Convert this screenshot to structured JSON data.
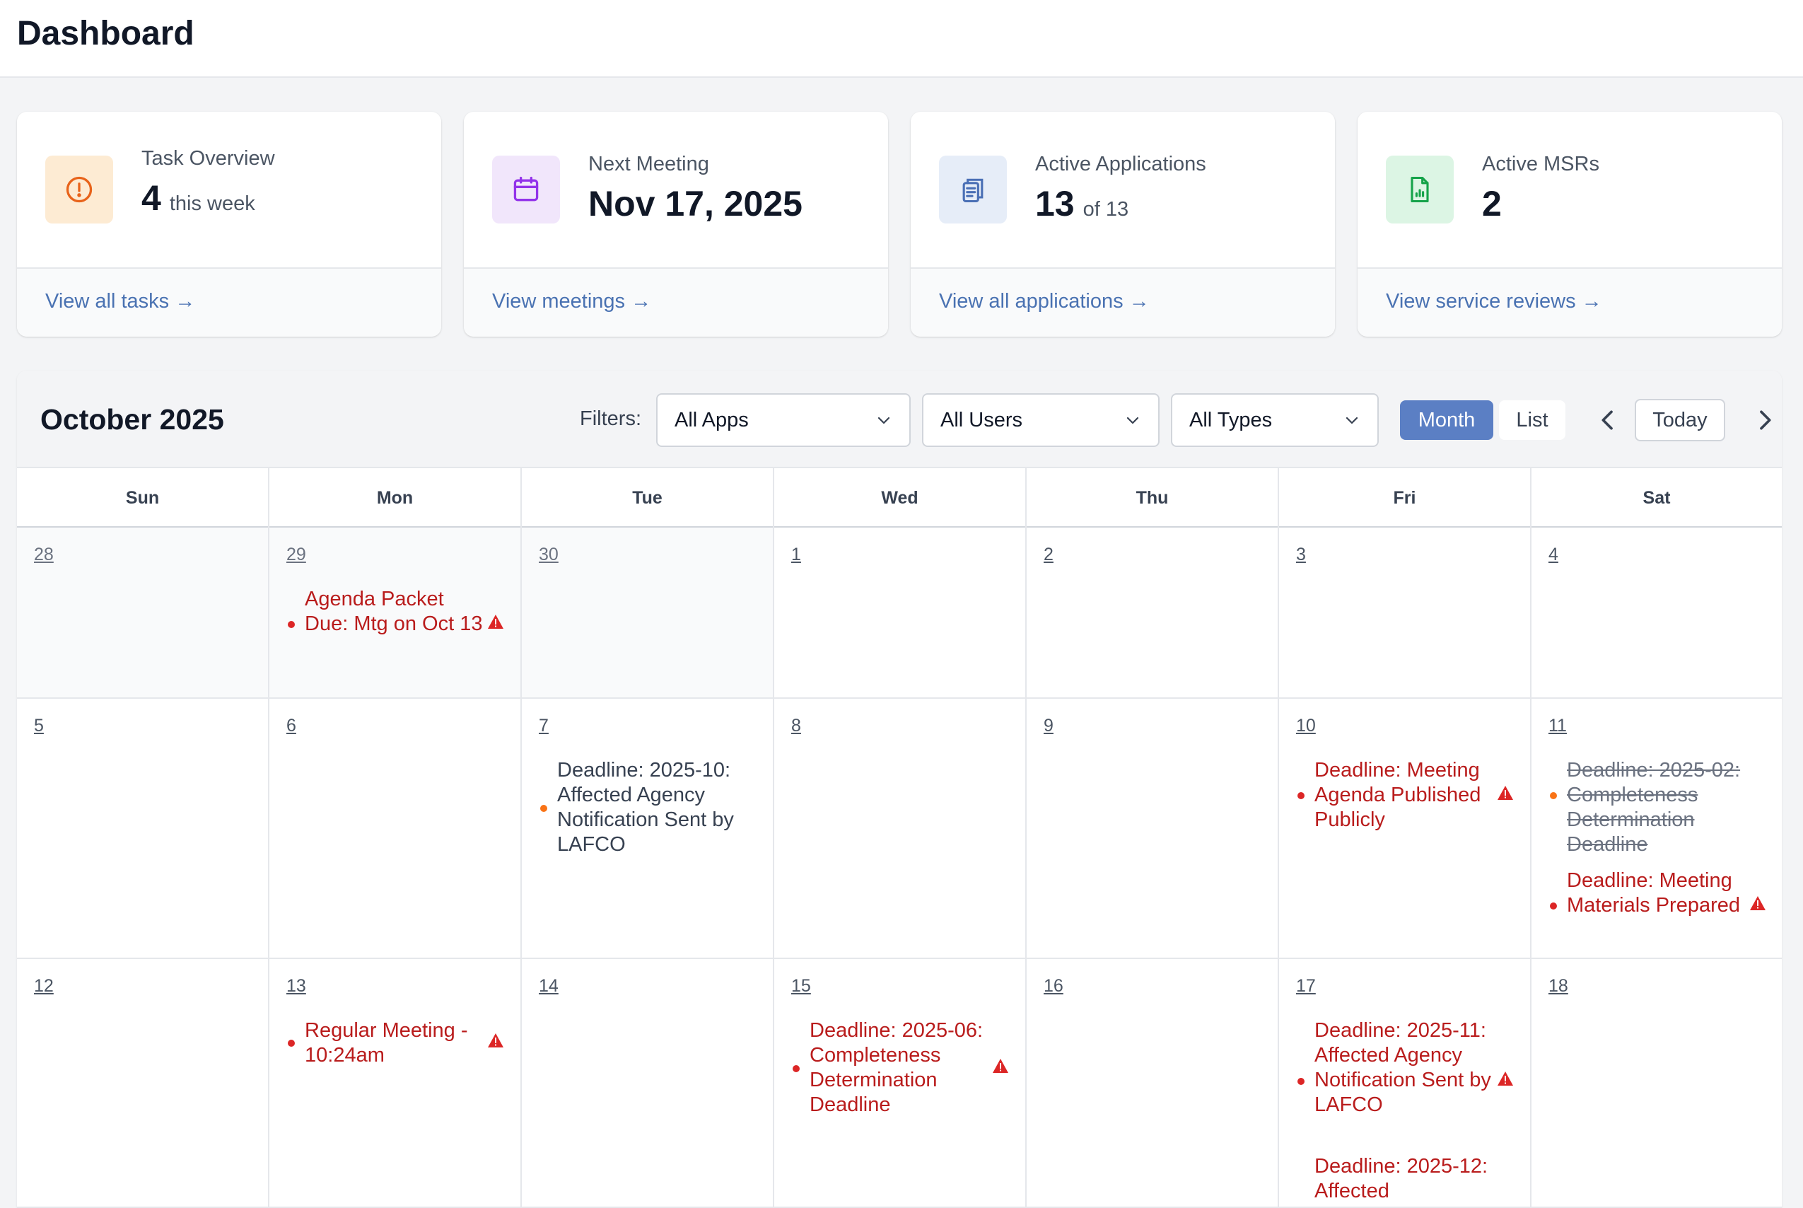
{
  "header": {
    "title": "Dashboard"
  },
  "cards": [
    {
      "label": "Task Overview",
      "value": "4",
      "sub": "this week",
      "link": "View all tasks →",
      "icon": "alert-circle-icon"
    },
    {
      "label": "Next Meeting",
      "value": "Nov 17, 2025",
      "sub": "",
      "link": "View meetings →",
      "icon": "calendar-icon"
    },
    {
      "label": "Active Applications",
      "value": "13",
      "sub": "of 13",
      "link": "View all applications →",
      "icon": "clipboard-icon"
    },
    {
      "label": "Active MSRs",
      "value": "2",
      "sub": "",
      "link": "View service reviews →",
      "icon": "document-chart-icon"
    }
  ],
  "calendar": {
    "title": "October 2025",
    "filters_label": "Filters:",
    "filters": [
      "All Apps",
      "All Users",
      "All Types"
    ],
    "view_month": "Month",
    "view_list": "List",
    "today": "Today",
    "weekdays": [
      "Sun",
      "Mon",
      "Tue",
      "Wed",
      "Thu",
      "Fri",
      "Sat"
    ],
    "weeks": [
      [
        "28",
        "29",
        "30",
        "1",
        "2",
        "3",
        "4"
      ],
      [
        "5",
        "6",
        "7",
        "8",
        "9",
        "10",
        "11"
      ],
      [
        "12",
        "13",
        "14",
        "15",
        "16",
        "17",
        "18"
      ]
    ],
    "events": {
      "e1": "Agenda Packet Due: Mtg on Oct 13",
      "e2": "Deadline: 2025-10: Affected Agency Notification Sent by LAFCO",
      "e3": "Deadline: Meeting Agenda Published Publicly",
      "e4": "Deadline: 2025-02: Completeness Determination Deadline",
      "e5": "Deadline: Meeting Materials Prepared",
      "e6": "Regular Meeting - 10:24am",
      "e7": "Deadline: 2025-06: Completeness Determination Deadline",
      "e8": "Deadline: 2025-11: Affected Agency Notification Sent by LAFCO",
      "e9": "Deadline: 2025-12: Affected"
    }
  },
  "colors": {
    "accent": "#5b7fc4",
    "link": "#4a72b2",
    "event_red": "#b91c1c",
    "event_dot_orange": "#f97316"
  }
}
